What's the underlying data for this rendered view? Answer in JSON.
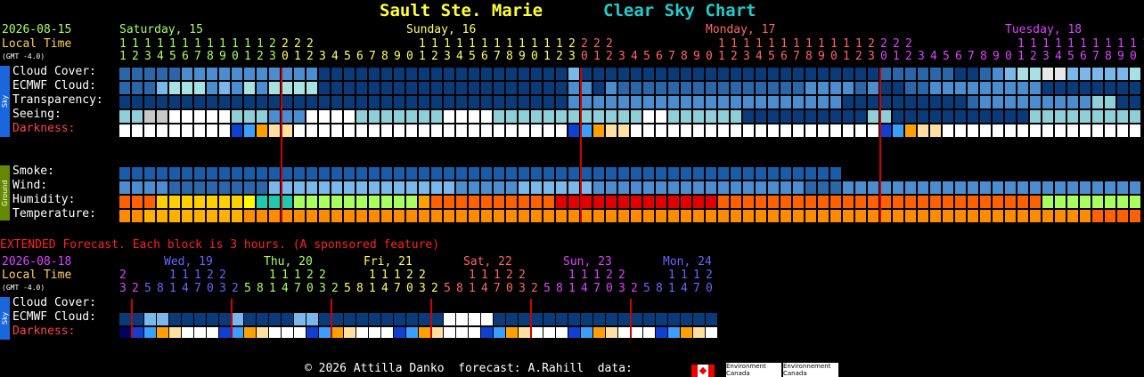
{
  "header": {
    "title_location": "Sault Ste. Marie",
    "title_chart": "Clear Sky Chart",
    "title_color_location": "#ffff33",
    "title_color_chart": "#22cccc"
  },
  "left_header": {
    "date": "2026-08-15",
    "local_time": "Local Time",
    "gmt": "(GMT -4.0)"
  },
  "days": [
    {
      "label": "Saturday, 15",
      "color": "#a8ff60"
    },
    {
      "label": "Sunday, 16",
      "color": "#ffff66"
    },
    {
      "label": "Monday, 17",
      "color": "#ff6666"
    },
    {
      "label": "Tuesday, 18",
      "color": "#dd44ff"
    }
  ],
  "hours_tens": "1111111111112222        1111111111112222        1111111111112222        111111111112",
  "hours_ones": "1234567890123012345678901234567890123012345678901234567890123012345678901234567890",
  "row_labels": {
    "sky": "Sky",
    "ground": "Ground",
    "cloud": "Cloud Cover:",
    "ecmwf": "ECMWF Cloud:",
    "transparency": "Transparency:",
    "seeing": "Seeing:",
    "darkness": "Darkness:",
    "smoke": "Smoke:",
    "wind": "Wind:",
    "humidity": "Humidity:",
    "temperature": "Temperature:"
  },
  "grid_rows": {
    "cloud": "1111122222222222000000000000000000003000000000000000000000000111111001234455333334433322230003002213322220110",
    "ecmwf": "1113444232424444000000000000000000002202111111111111111222212001122222222200000000444444444444443333333333",
    "transparency": "0000000000000000000000000000000000002222222222222222222222000000000012222222223300101111133322222222000000",
    "seeing": "3344555553332225555333333355553333333333335533333300000000003300000000000333333333334451113555333333555553",
    "darkness": "0000000004321100000000000000000000004321100000000000000000000432110000000000000000000043211000000000000",
    "smoke": "2222222222222222222222222222222222222222222222222222222222222222222222222222222222222222222222222222222",
    "wind": "2222111111113333333333333332222233333322222222222222222111222222222222222222222222222222222222111112222",
    "humidity": "2224444444588866666666663222222222211111111111112222222222222222222222222266666666665554332222211111113",
    "temperature": "3344444444333333333333333333333333333333333333333333333333333333333333333333332222222222222222333333333"
  },
  "extended": {
    "note": "EXTENDED Forecast. Each block is 3 hours. (A sponsored feature)",
    "date": "2026-08-18",
    "local_time": "Local Time",
    "gmt": "(GMT -4.0)",
    "days": [
      {
        "label": "Wed, 19",
        "color": "#6666ff"
      },
      {
        "label": "Thu, 20",
        "color": "#a8ff60"
      },
      {
        "label": "Fri, 21",
        "color": "#ffff66"
      },
      {
        "label": "Sat, 22",
        "color": "#ff6666"
      },
      {
        "label": "Sun, 23",
        "color": "#dd44ff"
      },
      {
        "label": "Mon, 24",
        "color": "#6666ff"
      }
    ],
    "hours_tens": "2   11122   11122   11122   11122   11122   1112",
    "hours_ones": "325814703258147032581470325814703258147032581470",
    "cloud_label": "Cloud Cover:",
    "ecmwf_label": "ECMWF Cloud:",
    "darkness_label": "Darkness:",
    "ecmwf": "111111111111111111111111111111111111111111111111",
    "cloud": "112211111211112211111111110000111111111111111111",
    "darkness": "543210004321000432100043210004321000432100043210"
  },
  "footer": {
    "copyright": "© 2026 Attilla Danko  forecast: A.Rahill  data:",
    "env1": "Environment\nCanada",
    "env2": "Environnement\nCanada"
  },
  "colors": {
    "cloud": [
      "#0a3b78",
      "#2a66a8",
      "#4c8dd0",
      "#7ab7ea",
      "#a6e2e2",
      "#e8e8e8",
      "#ffffff"
    ],
    "transparency": [
      "#0a3b78",
      "#2a66a8",
      "#4c8dd0",
      "#8fd0d8",
      "#ffffff"
    ],
    "seeing": [
      "#0a3b78",
      "#2a66a8",
      "#4c8dd0",
      "#8fd0d8",
      "#c8c8c8",
      "#ffffff"
    ],
    "darkness": [
      "#ffffff",
      "#ffe0a0",
      "#ffa000",
      "#3a9fff",
      "#1040d0",
      "#000060"
    ],
    "smoke": [
      "#0a3b78",
      "#2a66a8",
      "#1a5ca8"
    ],
    "wind": [
      "#0a3b78",
      "#2a66a8",
      "#4c8dd0",
      "#7ab7ea"
    ],
    "humidity": [
      "#c00000",
      "#e00000",
      "#ff6000",
      "#ffa000",
      "#ffd000",
      "#ffff00",
      "#a8ff60",
      "#40e070",
      "#20c8b0",
      "#22ddff"
    ],
    "temperature": [
      "#ff0000",
      "#ff3000",
      "#ff6000",
      "#ff8c00",
      "#ffb000"
    ]
  }
}
